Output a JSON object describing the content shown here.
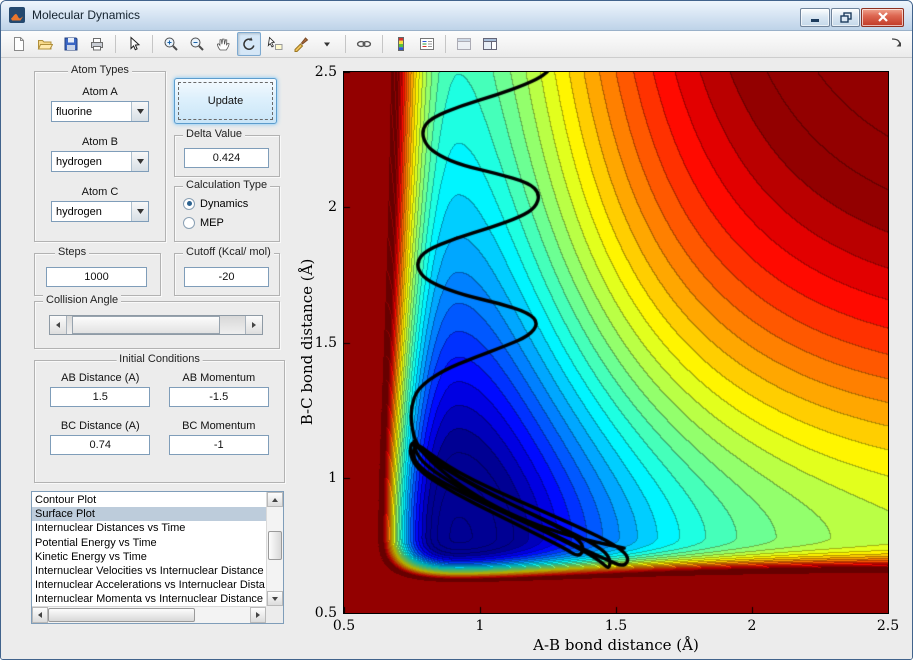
{
  "window": {
    "title": "Molecular Dynamics",
    "icon": "matlab-figure-icon",
    "controls": [
      "minimize-icon",
      "restore-icon",
      "close-icon"
    ]
  },
  "toolbar": {
    "icons": [
      {
        "name": "new-figure"
      },
      {
        "name": "open-file"
      },
      {
        "name": "save-figure"
      },
      {
        "name": "print-figure"
      },
      {
        "name": "separator"
      },
      {
        "name": "edit-arrow"
      },
      {
        "name": "separator"
      },
      {
        "name": "zoom-in"
      },
      {
        "name": "zoom-out"
      },
      {
        "name": "pan"
      },
      {
        "name": "rotate-3d",
        "active": true
      },
      {
        "name": "data-cursor"
      },
      {
        "name": "brush"
      },
      {
        "name": "brush-dropdown"
      },
      {
        "name": "separator"
      },
      {
        "name": "link-plots"
      },
      {
        "name": "separator"
      },
      {
        "name": "insert-colorbar"
      },
      {
        "name": "insert-legend"
      },
      {
        "name": "separator"
      },
      {
        "name": "hide-plot-tools"
      },
      {
        "name": "show-plot-tools"
      }
    ],
    "overflow_icon": "dock-arrow-icon"
  },
  "panels": {
    "atom_types": {
      "title": "Atom Types",
      "fields": [
        {
          "label": "Atom A",
          "value": "fluorine"
        },
        {
          "label": "Atom B",
          "value": "hydrogen"
        },
        {
          "label": "Atom C",
          "value": "hydrogen"
        }
      ]
    },
    "update_button": "Update",
    "delta": {
      "title": "Delta Value",
      "value": "0.424"
    },
    "calc_type": {
      "title": "Calculation Type",
      "options": [
        {
          "label": "Dynamics",
          "selected": true
        },
        {
          "label": "MEP",
          "selected": false
        }
      ]
    },
    "steps": {
      "title": "Steps",
      "value": "1000"
    },
    "cutoff": {
      "title": "Cutoff (Kcal/ mol)",
      "value": "-20"
    },
    "collision": {
      "title": "Collision Angle",
      "thumb_start": 0.03,
      "thumb_end": 0.86
    },
    "initial": {
      "title": "Initial Conditions",
      "fields": [
        {
          "label": "AB Distance (A)",
          "value": "1.5"
        },
        {
          "label": "AB Momentum",
          "value": "-1.5"
        },
        {
          "label": "BC Distance (A)",
          "value": "0.74"
        },
        {
          "label": "BC Momentum",
          "value": "-1"
        }
      ]
    },
    "plot_list": {
      "items": [
        "Contour Plot",
        "Surface Plot",
        "Internuclear Distances vs Time",
        "Potential Energy vs Time",
        "Kinetic Energy vs Time",
        "Internuclear Velocities vs Internuclear Distance",
        "Internuclear Accelerations vs Internuclear Dista",
        "Internuclear Momenta vs Internuclear Distance"
      ],
      "selected_index": 1,
      "scrollbars": {
        "vertical_thumb": [
          0.28,
          0.62
        ],
        "horizontal_thumb": [
          0.0,
          0.72
        ]
      }
    }
  },
  "colors": {
    "figure_bg": "#ececec",
    "list_selection": "#bdccdb",
    "close_button": "#c03a26",
    "update_focus_border": "#5c9ccc",
    "trajectory": "#000000"
  },
  "chart_data": {
    "type": "contour",
    "title": "",
    "xlabel": "A-B bond distance (Å)",
    "ylabel": "B-C bond distance (Å)",
    "xlim": [
      0.5,
      2.5
    ],
    "ylim": [
      0.5,
      2.5
    ],
    "xticks": [
      0.5,
      1,
      1.5,
      2,
      2.5
    ],
    "xtick_labels": [
      "0.5",
      "1",
      "1.5",
      "2",
      "2.5"
    ],
    "yticks": [
      0.5,
      1,
      1.5,
      2,
      2.5
    ],
    "ytick_labels": [
      "0.5",
      "1",
      "1.5",
      "2",
      "2.5"
    ],
    "grid": false,
    "colormap": "jet",
    "contour_levels": 26,
    "clim": [
      -1.73,
      -0.3
    ],
    "surface_model": {
      "form": "V(x,y)=morse(x)+morse(y); asymmetric-Morse approximation of a LEPS F+H2 potential energy surface, filled contours, high values clipped (cutoff)",
      "morse_x": {
        "r0": 0.92,
        "depth": 1.0,
        "a_inner": 2.9,
        "a_outer": 2.1
      },
      "morse_y": {
        "r0": 0.78,
        "depth": 0.85,
        "a_inner": 5.5,
        "a_outer": 1.5
      }
    },
    "trajectory": {
      "color": "#000000",
      "line_width": 3.4,
      "points": [
        [
          1.53,
          0.74
        ],
        [
          1.38,
          0.77
        ],
        [
          1.22,
          0.82
        ],
        [
          1.06,
          0.89
        ],
        [
          0.93,
          0.97
        ],
        [
          0.83,
          1.05
        ],
        [
          0.775,
          1.11
        ],
        [
          0.755,
          1.145
        ],
        [
          0.76,
          1.1
        ],
        [
          0.8,
          1.045
        ],
        [
          0.92,
          0.965
        ],
        [
          1.07,
          0.885
        ],
        [
          1.23,
          0.81
        ],
        [
          1.37,
          0.74
        ],
        [
          1.47,
          0.695
        ],
        [
          1.53,
          0.67
        ],
        [
          1.55,
          0.705
        ],
        [
          1.5,
          0.75
        ],
        [
          1.37,
          0.815
        ],
        [
          1.21,
          0.885
        ],
        [
          1.05,
          0.955
        ],
        [
          0.91,
          1.025
        ],
        [
          0.815,
          1.09
        ],
        [
          0.765,
          1.13
        ],
        [
          0.75,
          1.08
        ],
        [
          0.79,
          1.025
        ],
        [
          0.93,
          0.945
        ],
        [
          1.09,
          0.87
        ],
        [
          1.25,
          0.795
        ],
        [
          1.38,
          0.73
        ],
        [
          1.445,
          0.69
        ],
        [
          1.475,
          0.66
        ],
        [
          1.48,
          0.705
        ],
        [
          1.43,
          0.75
        ],
        [
          1.29,
          0.82
        ],
        [
          1.13,
          0.895
        ],
        [
          0.985,
          0.965
        ],
        [
          0.86,
          1.04
        ],
        [
          0.785,
          1.095
        ],
        [
          0.75,
          1.14
        ],
        [
          0.74,
          1.085
        ],
        [
          0.78,
          1.02
        ],
        [
          0.91,
          0.94
        ],
        [
          1.06,
          0.865
        ],
        [
          1.2,
          0.795
        ],
        [
          1.31,
          0.74
        ],
        [
          1.365,
          0.705
        ],
        [
          1.385,
          0.745
        ],
        [
          1.34,
          0.79
        ],
        [
          1.2,
          0.86
        ],
        [
          1.05,
          0.935
        ],
        [
          0.92,
          1.005
        ],
        [
          0.815,
          1.075
        ],
        [
          0.765,
          1.125
        ],
        [
          0.748,
          1.19
        ],
        [
          0.746,
          1.26
        ],
        [
          0.77,
          1.33
        ],
        [
          0.86,
          1.395
        ],
        [
          0.98,
          1.445
        ],
        [
          1.1,
          1.49
        ],
        [
          1.18,
          1.525
        ],
        [
          1.215,
          1.57
        ],
        [
          1.18,
          1.61
        ],
        [
          1.07,
          1.645
        ],
        [
          0.94,
          1.675
        ],
        [
          0.845,
          1.71
        ],
        [
          0.785,
          1.745
        ],
        [
          0.765,
          1.795
        ],
        [
          0.8,
          1.84
        ],
        [
          0.91,
          1.885
        ],
        [
          1.04,
          1.925
        ],
        [
          1.15,
          1.965
        ],
        [
          1.205,
          2.0
        ],
        [
          1.22,
          2.05
        ],
        [
          1.18,
          2.09
        ],
        [
          1.06,
          2.125
        ],
        [
          0.935,
          2.155
        ],
        [
          0.85,
          2.19
        ],
        [
          0.8,
          2.23
        ],
        [
          0.785,
          2.285
        ],
        [
          0.82,
          2.33
        ],
        [
          0.93,
          2.375
        ],
        [
          1.06,
          2.415
        ],
        [
          1.17,
          2.455
        ],
        [
          1.24,
          2.49
        ],
        [
          1.27,
          2.53
        ]
      ]
    }
  }
}
